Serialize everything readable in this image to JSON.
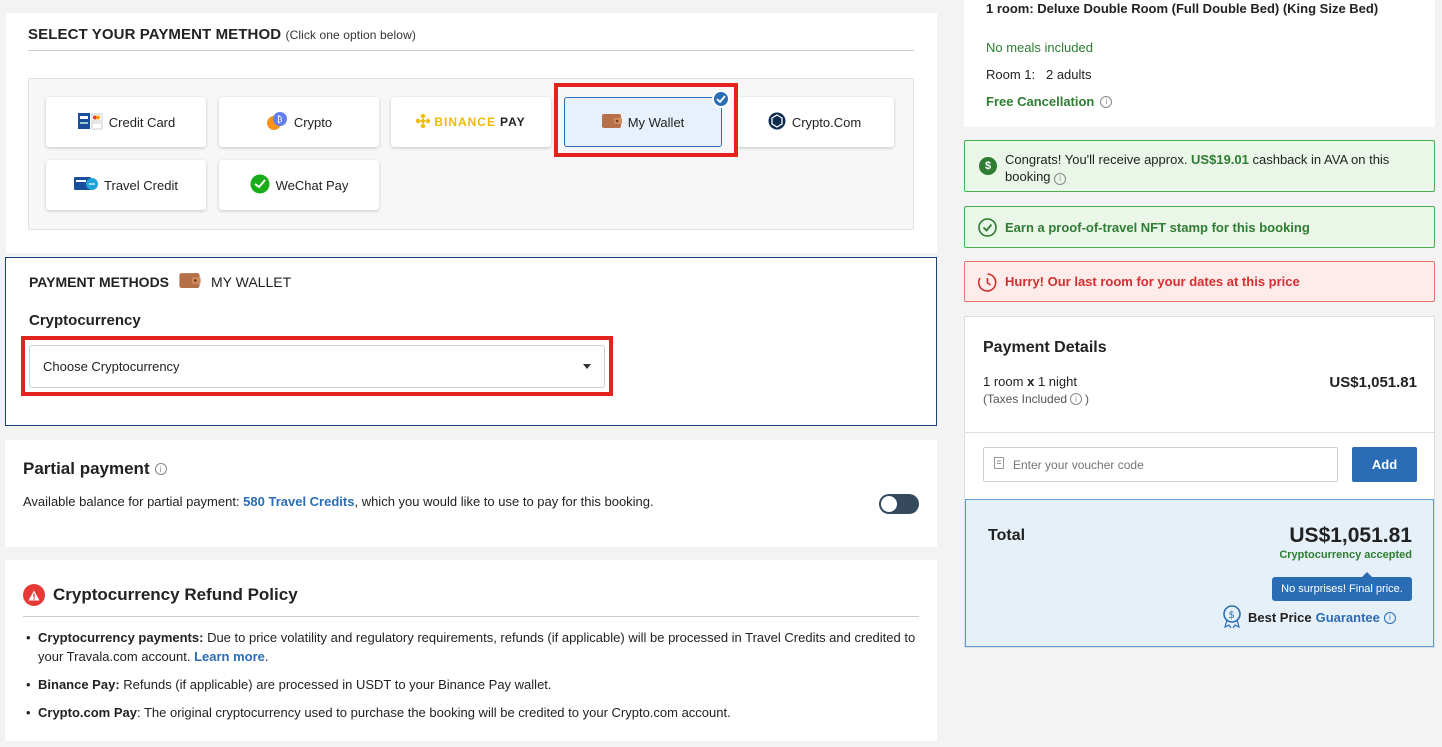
{
  "payment_select": {
    "title": "SELECT YOUR PAYMENT METHOD",
    "subtitle": "(Click one option below)",
    "options": [
      {
        "label": "Credit Card",
        "icon": "credit-card-icon"
      },
      {
        "label": "Crypto",
        "icon": "crypto-icon"
      },
      {
        "label_brand": "BINANCE",
        "label_rest": "PAY",
        "icon": "binance-icon"
      },
      {
        "label": "My Wallet",
        "icon": "wallet-icon",
        "selected": true
      },
      {
        "label": "Crypto.Com",
        "icon": "crypto-com-icon"
      },
      {
        "label": "Travel Credit",
        "icon": "travel-credit-icon"
      },
      {
        "label": "WeChat Pay",
        "icon": "wechat-icon"
      }
    ]
  },
  "payment_methods": {
    "heading": "PAYMENT METHODS",
    "method": "MY WALLET",
    "crypto_label": "Cryptocurrency",
    "crypto_select": "Choose Cryptocurrency"
  },
  "partial": {
    "title": "Partial payment",
    "text_before": "Available balance for partial payment: ",
    "balance": "580 Travel Credits",
    "text_after": ", which you would like to use to pay for this booking.",
    "toggle_on": false
  },
  "refund": {
    "title": "Cryptocurrency Refund Policy",
    "items": [
      {
        "bold": "Cryptocurrency payments:",
        "text": " Due to price volatility and regulatory requirements, refunds (if applicable) will be processed in Travel Credits and credited to your Travala.com account. ",
        "link": "Learn more",
        "end": "."
      },
      {
        "bold": "Binance Pay:",
        "text": " Refunds (if applicable) are processed in USDT to your Binance Pay wallet."
      },
      {
        "bold": "Crypto.com Pay",
        "text": ": The original cryptocurrency used to purchase the booking will be credited to your Crypto.com account."
      }
    ]
  },
  "room": {
    "title": "1 room: Deluxe Double Room (Full Double Bed) (King Size Bed)",
    "meals": "No meals included",
    "occupancy_label": "Room 1:",
    "occupancy": "2 adults",
    "cancellation": "Free Cancellation"
  },
  "banners": {
    "cashback_before": "Congrats! You'll receive approx. ",
    "cashback_amount": "US$19.01",
    "cashback_after": " cashback in AVA on this booking",
    "nft": "Earn a proof-of-travel NFT stamp for this booking",
    "hurry": "Hurry! Our last room for your dates at this price"
  },
  "details": {
    "title": "Payment Details",
    "rooms": "1 room",
    "x": "x",
    "nights": "1 night",
    "taxes": "(Taxes Included",
    "taxes_end": ")",
    "price": "US$1,051.81",
    "voucher_placeholder": "Enter your voucher code",
    "add": "Add",
    "total_label": "Total",
    "total": "US$1,051.81",
    "accepted": "Cryptocurrency accepted",
    "tooltip": "No surprises! Final price.",
    "best_price": "Best Price",
    "guarantee": "Guarantee"
  },
  "colors": {
    "accent_blue": "#2a6db5",
    "green": "#2e7d32",
    "red": "#d32f2f",
    "highlight": "#e4231f",
    "binance": "#f0b90b"
  }
}
